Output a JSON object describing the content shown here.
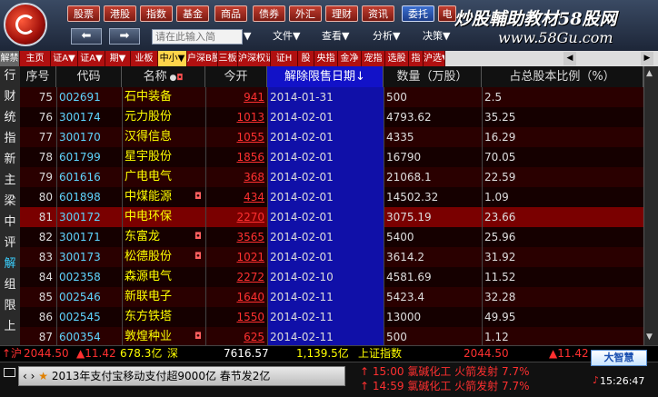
{
  "menu": [
    "股票",
    "港股",
    "指数",
    "基金",
    "商品",
    "债券",
    "外汇",
    "理财",
    "资讯",
    "委托",
    "电"
  ],
  "menu_active_index": 9,
  "watermark": {
    "line1": "炒股輔助教材58股网",
    "line2": "www.58Gu.com"
  },
  "search": {
    "placeholder": "请在此输入简"
  },
  "dropdowns": {
    "file": "文件▼",
    "view": "查看▼",
    "analysis": "分析▼",
    "decision": "决策▼"
  },
  "nav": {
    "back": "⬅",
    "forward": "➡"
  },
  "tabs": [
    "解禁",
    "主页",
    "证A▼",
    "证A▼",
    "期▼",
    "业板",
    "中小▼",
    "户深B股",
    "三板",
    "沪深权证",
    "证H",
    "股",
    "央指",
    "金净",
    "宠指",
    "选股",
    "指",
    "沪选▼"
  ],
  "tab_selected_index": 6,
  "leftbar": [
    "行",
    "财",
    "统",
    "指",
    "新",
    "主",
    "梁",
    "中",
    "评",
    "解",
    "组",
    "限",
    "上"
  ],
  "leftbar_selected_index": 9,
  "columns": {
    "seq": "序号",
    "code": "代码",
    "name": "名称",
    "open": "今开",
    "date": "解除限售日期↓",
    "qty": "数量（万股）",
    "pct": "占总股本比例（%）"
  },
  "rows": [
    {
      "seq": "75",
      "code": "002691",
      "name": "石中装备",
      "flag": "",
      "open": "941",
      "date": "2014-01-31",
      "qty": "500",
      "pct": "2.5"
    },
    {
      "seq": "76",
      "code": "300174",
      "name": "元力股份",
      "flag": "",
      "open": "1013",
      "date": "2014-02-01",
      "qty": "4793.62",
      "pct": "35.25"
    },
    {
      "seq": "77",
      "code": "300170",
      "name": "汉得信息",
      "flag": "",
      "open": "1055",
      "date": "2014-02-01",
      "qty": "4335",
      "pct": "16.29"
    },
    {
      "seq": "78",
      "code": "601799",
      "name": "星宇股份",
      "flag": "",
      "open": "1856",
      "date": "2014-02-01",
      "qty": "16790",
      "pct": "70.05"
    },
    {
      "seq": "79",
      "code": "601616",
      "name": "广电电气",
      "flag": "",
      "open": "368",
      "date": "2014-02-01",
      "qty": "21068.1",
      "pct": "22.59"
    },
    {
      "seq": "80",
      "code": "601898",
      "name": "中煤能源",
      "flag": "◘",
      "open": "434",
      "date": "2014-02-01",
      "qty": "14502.32",
      "pct": "1.09"
    },
    {
      "seq": "81",
      "code": "300172",
      "name": "中电环保",
      "flag": "",
      "open": "2270",
      "date": "2014-02-01",
      "qty": "3075.19",
      "pct": "23.66"
    },
    {
      "seq": "82",
      "code": "300171",
      "name": "东富龙",
      "flag": "◘",
      "open": "3565",
      "date": "2014-02-01",
      "qty": "5400",
      "pct": "25.96"
    },
    {
      "seq": "83",
      "code": "300173",
      "name": "松德股份",
      "flag": "◘",
      "open": "1021",
      "date": "2014-02-01",
      "qty": "3614.2",
      "pct": "31.92"
    },
    {
      "seq": "84",
      "code": "002358",
      "name": "森源电气",
      "flag": "",
      "open": "2272",
      "date": "2014-02-10",
      "qty": "4581.69",
      "pct": "11.52"
    },
    {
      "seq": "85",
      "code": "002546",
      "name": "新联电子",
      "flag": "",
      "open": "1640",
      "date": "2014-02-11",
      "qty": "5423.4",
      "pct": "32.28"
    },
    {
      "seq": "86",
      "code": "002545",
      "name": "东方铁塔",
      "flag": "",
      "open": "1550",
      "date": "2014-02-11",
      "qty": "13000",
      "pct": "49.95"
    },
    {
      "seq": "87",
      "code": "600354",
      "name": "敦煌种业",
      "flag": "◘",
      "open": "625",
      "date": "2014-02-11",
      "qty": "500",
      "pct": "1.12"
    }
  ],
  "highlight_rows": [
    6
  ],
  "status": {
    "sh_label": "沪",
    "sh_val": "2044.50",
    "sh_chg": "▲11.42",
    "sh_amt": "678.3亿",
    "sz_label": "深",
    "sz_val": "7616.57",
    "sz_amt": "1,139.5亿",
    "idx_name": "上证指数",
    "idx_val": "2044.50",
    "idx_chg": "▲11.42"
  },
  "news": {
    "text": "2013年支付宝移动支付超9000亿 春节发2亿"
  },
  "alerts": [
    {
      "time": "15:00",
      "name": "氯碱化工",
      "event": "火箭发射",
      "pct": "7.7%"
    },
    {
      "time": "14:59",
      "name": "氯碱化工",
      "event": "火箭发射",
      "pct": "7.7%"
    }
  ],
  "brand": "大智慧",
  "clock": "15:26:47",
  "colors": {
    "up": "#ff3030",
    "code": "#5fd5ff",
    "name": "#ffff00",
    "sort_col": "#1010a8",
    "highlight": "#7a0000"
  }
}
